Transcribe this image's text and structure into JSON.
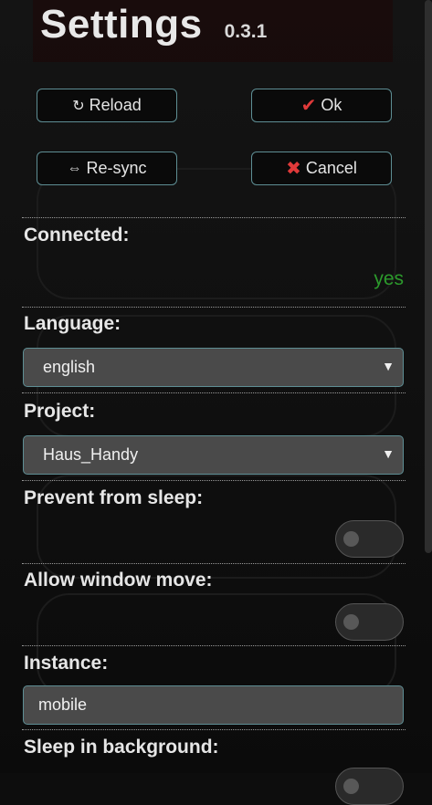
{
  "header": {
    "title": "Settings",
    "version": "0.3.1"
  },
  "buttons": {
    "reload": {
      "label": "Reload",
      "icon": "refresh-icon",
      "glyph": "↻"
    },
    "ok": {
      "label": "Ok",
      "icon": "check-icon",
      "glyph": "✔"
    },
    "resync": {
      "label": "Re-sync",
      "icon": "arrows-icon",
      "glyph": "⇔"
    },
    "cancel": {
      "label": "Cancel",
      "icon": "cross-icon",
      "glyph": "✖"
    }
  },
  "settings": {
    "connected": {
      "label": "Connected:",
      "value": "yes"
    },
    "language": {
      "label": "Language:",
      "selected": "english"
    },
    "project": {
      "label": "Project:",
      "selected": "Haus_Handy"
    },
    "prevent_sleep": {
      "label": "Prevent from sleep:",
      "enabled": false
    },
    "allow_window_move": {
      "label": "Allow window move:",
      "enabled": false
    },
    "instance": {
      "label": "Instance:",
      "value": "mobile"
    },
    "sleep_background": {
      "label": "Sleep in background:"
    }
  },
  "colors": {
    "accent_border": "#5e8e94",
    "status_ok": "#2c9a2c",
    "icon_red": "#e03a3a"
  }
}
